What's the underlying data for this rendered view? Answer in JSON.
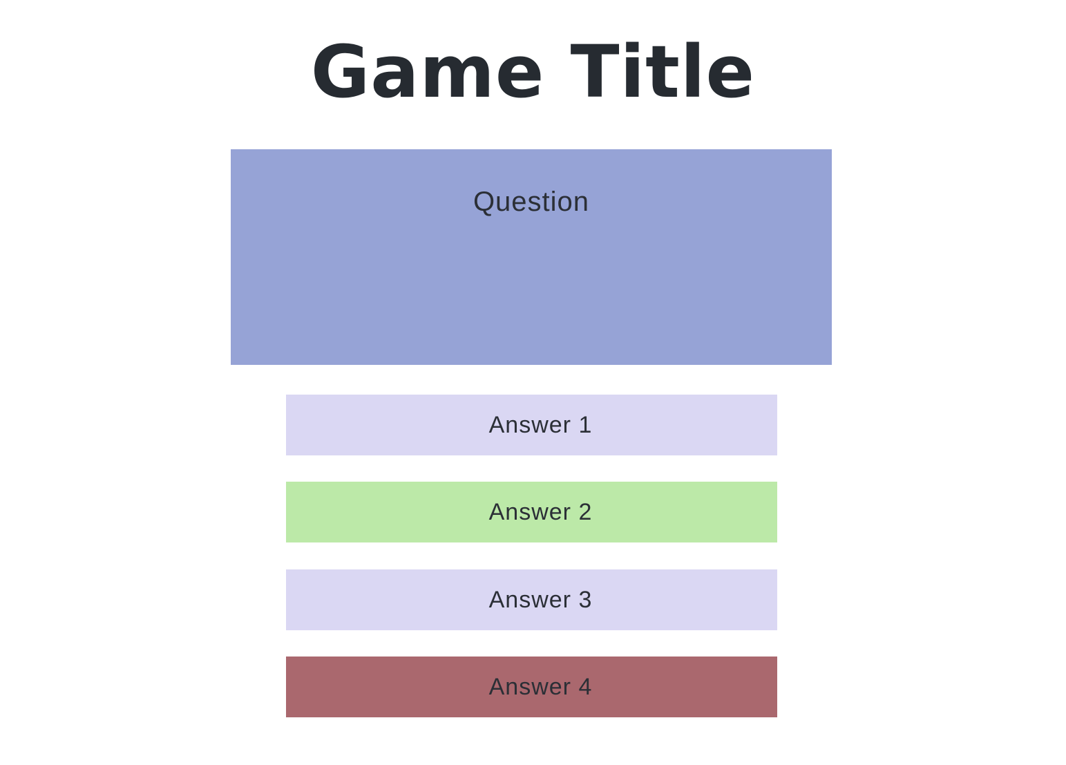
{
  "title": "Game Title",
  "question": {
    "label": "Question",
    "background": "#96a3d6"
  },
  "answers": [
    {
      "label": "Answer 1",
      "state": "neutral",
      "color": "#dad7f3"
    },
    {
      "label": "Answer 2",
      "state": "correct",
      "color": "#bce9a8"
    },
    {
      "label": "Answer 3",
      "state": "neutral",
      "color": "#dad7f3"
    },
    {
      "label": "Answer 4",
      "state": "incorrect",
      "color": "#aa686e"
    }
  ]
}
